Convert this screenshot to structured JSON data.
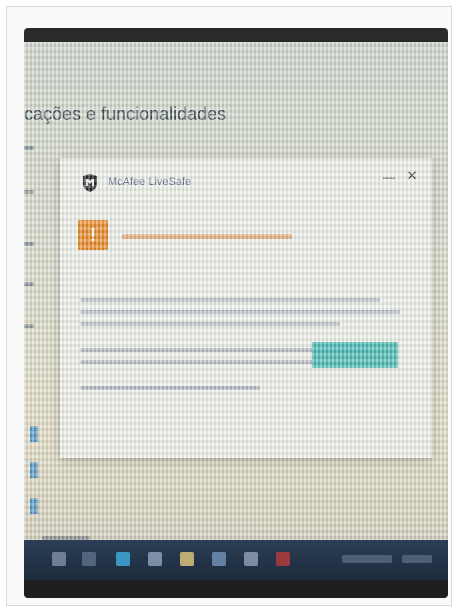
{
  "settings": {
    "title": "cações e funcionalidades"
  },
  "popup": {
    "title": "McAfee LiveSafe",
    "minimize_glyph": "—",
    "close_glyph": "✕",
    "warning_glyph": "!"
  },
  "colors": {
    "warning": "#e98a2c",
    "accent_button": "#3bb6b0",
    "taskbar": "#1d2b3d"
  },
  "taskbar": {
    "icons": [
      "start-icon",
      "search-icon",
      "task-view-icon",
      "edge-icon",
      "file-explorer-icon",
      "store-icon",
      "mail-icon",
      "mcafee-icon"
    ]
  }
}
